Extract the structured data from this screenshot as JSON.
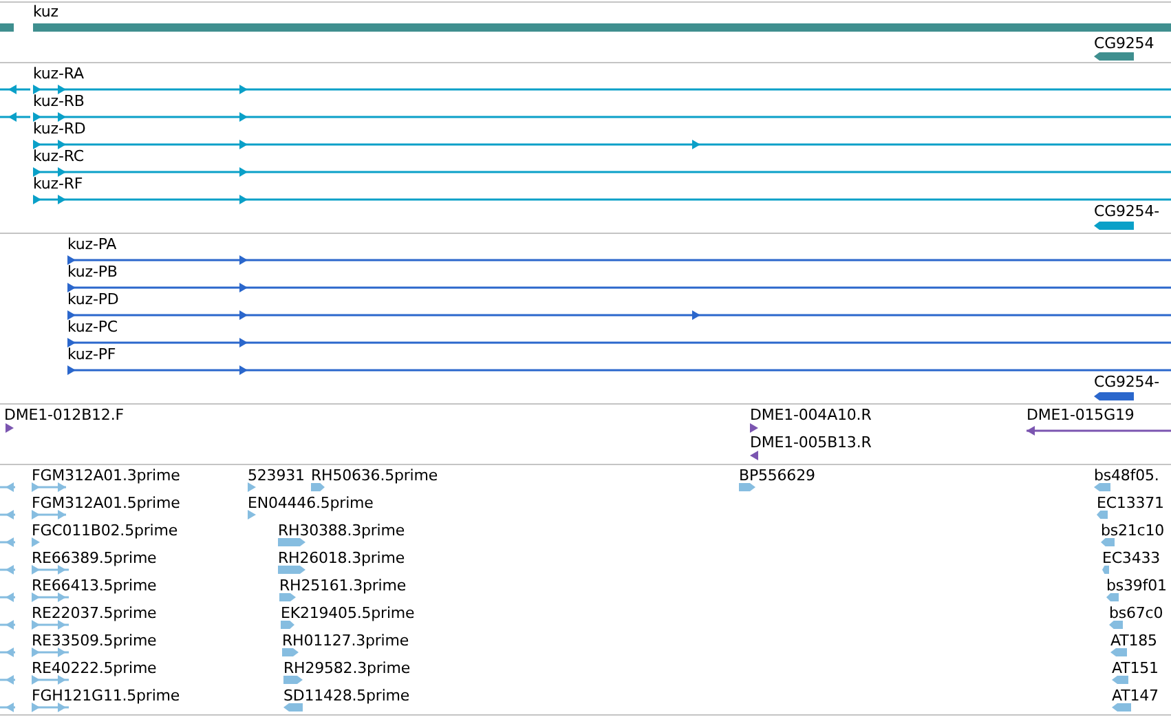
{
  "tracks": [
    {
      "color": "#3f8f8f",
      "features": [
        {
          "label": "kuz"
        },
        {
          "label": "CG9254",
          "reverse": true
        }
      ]
    },
    {
      "color": "#0aa0c8",
      "features": [
        {
          "reverse": true
        },
        {
          "label": "kuz-RA",
          "reverse": false
        },
        {
          "reverse": true
        },
        {
          "label": "kuz-RB",
          "reverse": false
        },
        {
          "label": "kuz-RD",
          "reverse": false
        },
        {
          "label": "kuz-RC",
          "reverse": false
        },
        {
          "label": "kuz-RF",
          "reverse": false
        },
        {
          "label": "CG9254-",
          "reverse": true
        }
      ]
    },
    {
      "color": "#2b67cc",
      "features": [
        {
          "label": "kuz-PA",
          "reverse": false
        },
        {
          "label": "kuz-PB",
          "reverse": false
        },
        {
          "label": "kuz-PD",
          "reverse": false
        },
        {
          "label": "kuz-PC",
          "reverse": false
        },
        {
          "label": "kuz-PF",
          "reverse": false
        },
        {
          "label": "CG9254-",
          "reverse": true
        }
      ]
    },
    {
      "color": "#7b55b0",
      "features": [
        {
          "label": "DME1-012B12.F",
          "reverse": false
        },
        {
          "label": "DME1-004A10.R",
          "reverse": false
        },
        {
          "label": "DME1-005B13.R",
          "reverse": true
        },
        {
          "label": "DME1-015G19",
          "reverse": true
        }
      ]
    },
    {
      "color": "#86bde0",
      "features": [
        {
          "reverse": true
        },
        {
          "label": "FGM312A01.3prime",
          "reverse": false
        },
        {
          "label": "523931",
          "reverse": false
        },
        {
          "label": "RH50636.5prime",
          "reverse": false
        },
        {
          "label": "BP556629",
          "reverse": false
        },
        {
          "label": "bs48f05.",
          "reverse": true
        },
        {
          "reverse": true
        },
        {
          "label": "FGM312A01.5prime",
          "reverse": false
        },
        {
          "label": "EN04446.5prime",
          "reverse": false
        },
        {
          "label": "EC13371",
          "reverse": true
        },
        {
          "reverse": true
        },
        {
          "label": "FGC011B02.5prime",
          "reverse": false
        },
        {
          "label": "RH30388.3prime",
          "reverse": false
        },
        {
          "label": "bs21c10",
          "reverse": true
        },
        {
          "reverse": true
        },
        {
          "label": "RE66389.5prime",
          "reverse": false
        },
        {
          "label": "RH26018.3prime",
          "reverse": false
        },
        {
          "label": "EC3433",
          "reverse": true
        },
        {
          "reverse": true
        },
        {
          "label": "RE66413.5prime",
          "reverse": false
        },
        {
          "label": "RH25161.3prime",
          "reverse": false
        },
        {
          "label": "bs39f01",
          "reverse": true
        },
        {
          "reverse": true
        },
        {
          "label": "RE22037.5prime",
          "reverse": false
        },
        {
          "label": "EK219405.5prime",
          "reverse": false
        },
        {
          "label": "bs67c0",
          "reverse": true
        },
        {
          "reverse": true
        },
        {
          "label": "RE33509.5prime",
          "reverse": false
        },
        {
          "label": "RH01127.3prime",
          "reverse": false
        },
        {
          "label": "AT185",
          "reverse": true
        },
        {
          "reverse": true
        },
        {
          "label": "RE40222.5prime",
          "reverse": false
        },
        {
          "label": "RH29582.3prime",
          "reverse": false
        },
        {
          "label": "AT151",
          "reverse": true
        },
        {
          "reverse": true
        },
        {
          "label": "FGH121G11.5prime",
          "reverse": false
        },
        {
          "label": "SD11428.5prime",
          "reverse": true
        },
        {
          "label": "AT147",
          "reverse": true
        }
      ]
    }
  ]
}
